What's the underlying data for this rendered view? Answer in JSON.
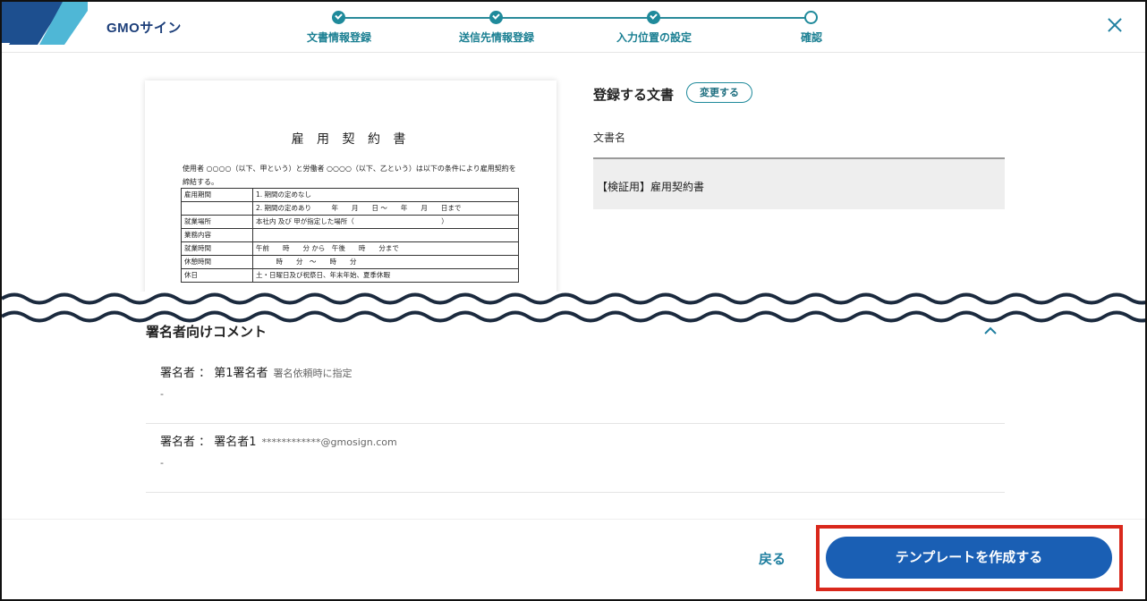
{
  "header": {
    "brand": "GMOサイン",
    "steps": [
      {
        "label": "文書情報登録",
        "status": "done"
      },
      {
        "label": "送信先情報登録",
        "status": "done"
      },
      {
        "label": "入力位置の設定",
        "status": "done"
      },
      {
        "label": "確認",
        "status": "current"
      }
    ],
    "colors": {
      "accent": "#1f8a9b",
      "logo_dark": "#1d4f8f",
      "logo_light": "#4fb7d6"
    }
  },
  "document_preview": {
    "title": "雇 用 契 約 書",
    "intro": "使用者 ○○○○（以下、甲という）と労働者 ○○○○（以下、乙という）は以下の条件により雇用契約を締結する。",
    "rows": [
      {
        "k": "雇用期間",
        "v": "1. 期間の定めなし"
      },
      {
        "k": "",
        "v": "2. 期間の定めあり　　　年　　月　　日 〜　　年　　月　　日まで"
      },
      {
        "k": "就業場所",
        "v": "本社内 及び 甲が指定した場所（　　　　　　　　　　　　　）"
      },
      {
        "k": "業務内容",
        "v": ""
      },
      {
        "k": "就業時間",
        "v": "午前　　時　　分 から　午後　　時　　分まで"
      },
      {
        "k": "休憩時間",
        "v": "　　　時　　分　〜　　時　　分"
      },
      {
        "k": "休日",
        "v": "土・日曜日及び祝祭日、年末年始、夏季休暇"
      }
    ]
  },
  "document_info": {
    "heading": "登録する文書",
    "change_label": "変更する",
    "name_label": "文書名",
    "name_value": "【検証用】雇用契約書"
  },
  "comments": {
    "heading": "署名者向けコメント",
    "signers": [
      {
        "prefix": "署名者 ： 第1署名者",
        "note": "署名依頼時に指定",
        "comment": "-"
      },
      {
        "prefix": "署名者 ： 署名者1",
        "note": "************@gmosign.com",
        "comment": "-"
      }
    ]
  },
  "footer": {
    "back_label": "戻る",
    "create_label": "テンプレートを作成する",
    "highlight_color": "#d9281c",
    "button_color": "#1a5fb4"
  }
}
